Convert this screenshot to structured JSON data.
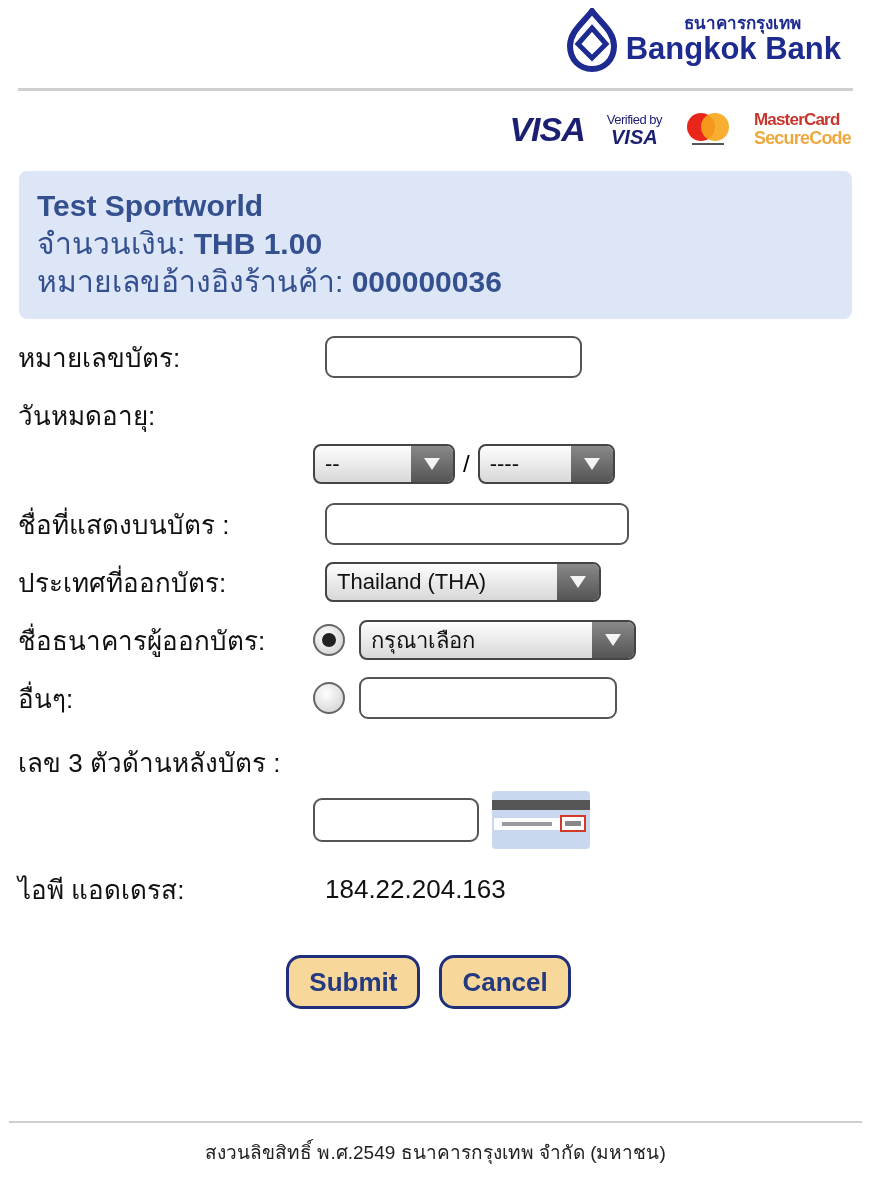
{
  "header": {
    "bank_name_thai": "ธนาคารกรุงเทพ",
    "bank_name": "Bangkok Bank"
  },
  "card_logos": [
    {
      "kind": "visa",
      "text": "VISA"
    },
    {
      "kind": "verified",
      "caption": "Verified by",
      "text": "VISA"
    },
    {
      "kind": "mastercard"
    },
    {
      "kind": "securecode",
      "caption": "MasterCard",
      "text": "SecureCode"
    }
  ],
  "merchant": {
    "name": "Test Sportworld",
    "amount_label": "จำนวนเงิน:",
    "amount": "THB 1.00",
    "ref_label": "หมายเลขอ้างอิงร้านค้า:",
    "ref": "000000036"
  },
  "fields": [
    {
      "kind": "text",
      "label": "หมายเลขบัตร:"
    },
    {
      "kind": "expiry",
      "label": "วันหมดอายุ:",
      "month": "--",
      "separator": "/",
      "year": "----"
    },
    {
      "kind": "text_wide",
      "label": "ชื่อที่แสดงบนบัตร :"
    },
    {
      "kind": "select",
      "label": "ประเทศที่ออกบัตร:",
      "value": "Thailand (THA)"
    },
    {
      "kind": "radio_select",
      "label": "ชื่อธนาคารผู้ออกบัตร:",
      "selected": true,
      "value": "กรุณาเลือก"
    },
    {
      "kind": "radio_text",
      "label": "อื่นๆ:",
      "selected": false
    },
    {
      "kind": "cvv",
      "label": "เลข 3 ตัวด้านหลังบัตร :"
    },
    {
      "kind": "info",
      "label": "ไอพี แอดเดรส:",
      "value": "184.22.204.163"
    }
  ],
  "buttons": [
    "Submit",
    "Cancel"
  ],
  "footer": "สงวนลิขสิทธิ์ พ.ศ.2549 ธนาคารกรุงเทพ จำกัด (มหาชน)"
}
